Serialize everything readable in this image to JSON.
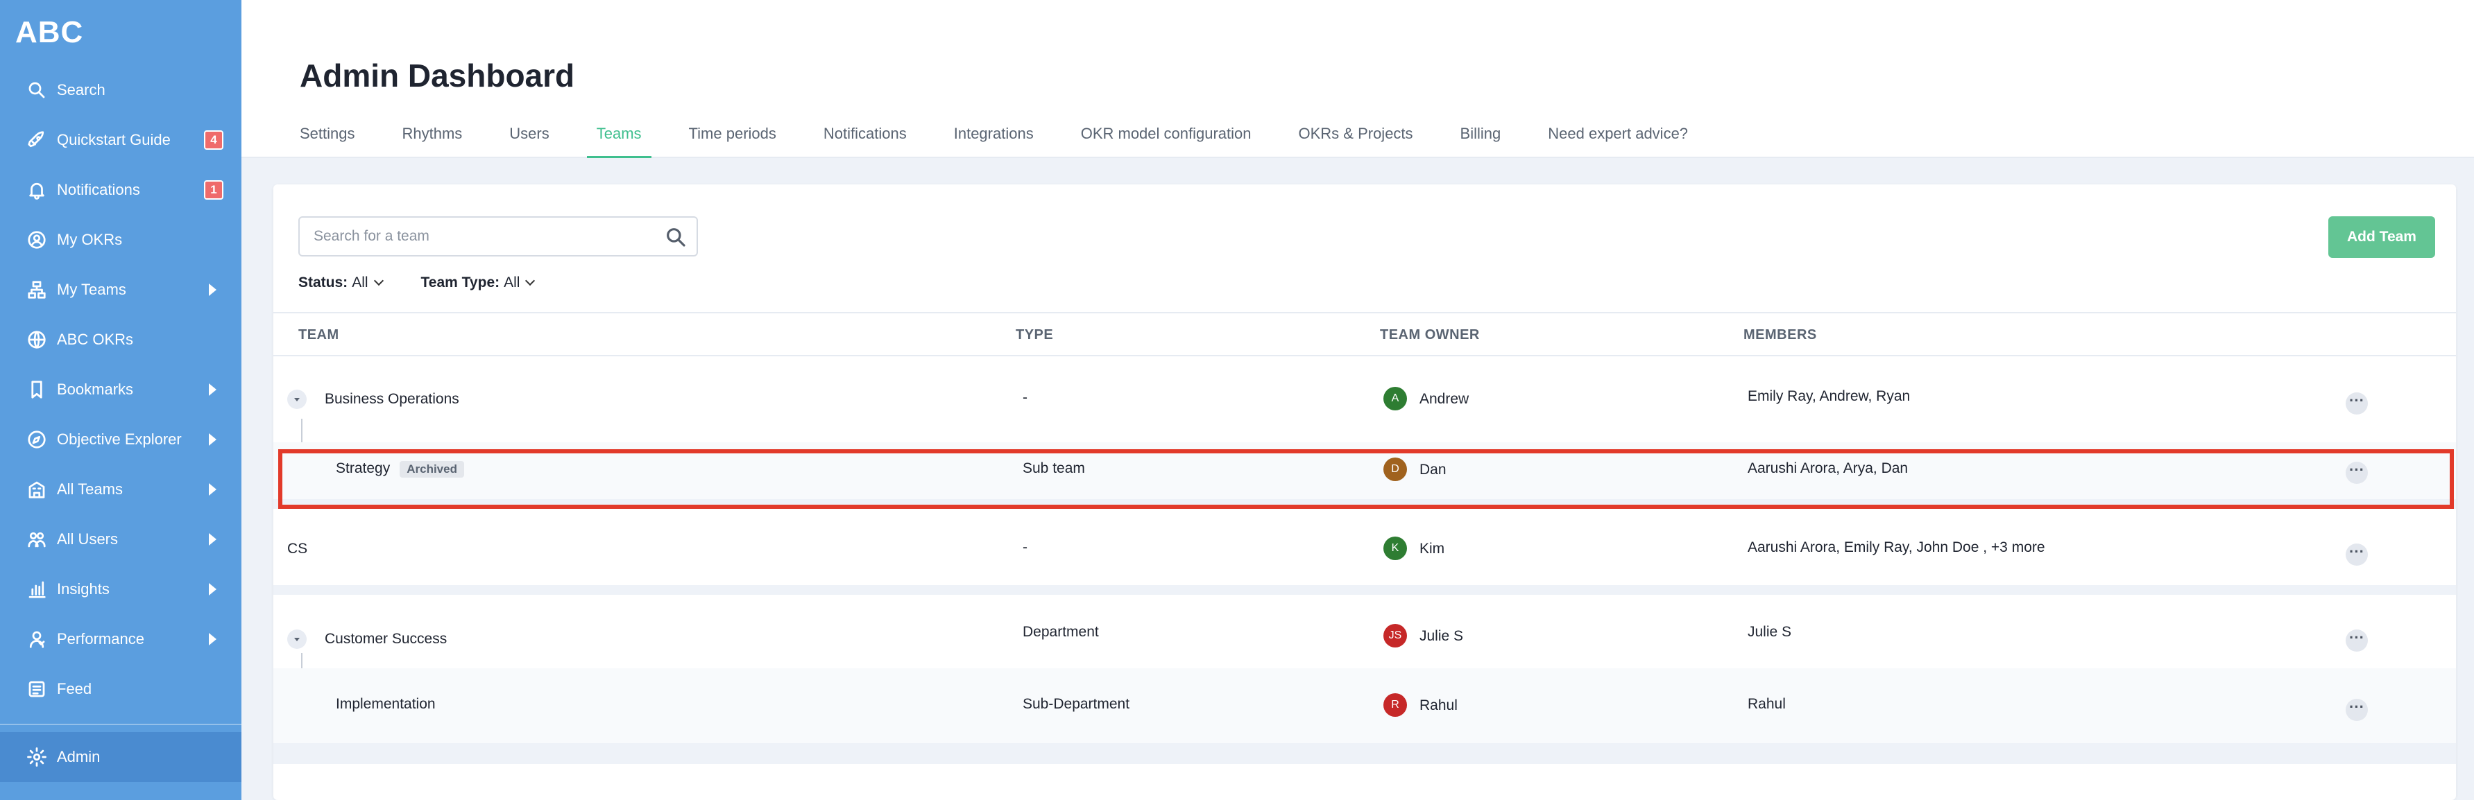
{
  "app": {
    "brand": "ABC"
  },
  "sidebar": {
    "items": [
      {
        "label": "Search",
        "icon": "search-icon"
      },
      {
        "label": "Quickstart Guide",
        "icon": "rocket-icon",
        "badge": "4"
      },
      {
        "label": "Notifications",
        "icon": "bell-icon",
        "badge": "1"
      },
      {
        "label": "My OKRs",
        "icon": "user-circle-icon"
      },
      {
        "label": "My Teams",
        "icon": "team-tree-icon"
      },
      {
        "label": "ABC OKRs",
        "icon": "globe-icon"
      },
      {
        "label": "Bookmarks",
        "icon": "bookmark-icon"
      },
      {
        "label": "Objective Explorer",
        "icon": "compass-icon"
      },
      {
        "label": "All Teams",
        "icon": "building-icon"
      },
      {
        "label": "All Users",
        "icon": "users-icon"
      },
      {
        "label": "Insights",
        "icon": "bar-chart-icon"
      },
      {
        "label": "Performance",
        "icon": "performance-icon"
      },
      {
        "label": "Feed",
        "icon": "feed-icon"
      }
    ],
    "admin": {
      "label": "Admin",
      "icon": "gear-icon"
    }
  },
  "header": {
    "title": "Admin Dashboard",
    "tabs": [
      "Settings",
      "Rhythms",
      "Users",
      "Teams",
      "Time periods",
      "Notifications",
      "Integrations",
      "OKR model configuration",
      "OKRs & Projects",
      "Billing",
      "Need expert advice?"
    ],
    "active_tab": "Teams"
  },
  "toolbar": {
    "search_placeholder": "Search for a team",
    "add_button": "Add Team",
    "filters": [
      {
        "label": "Status:",
        "value": "All"
      },
      {
        "label": "Team Type:",
        "value": "All"
      }
    ]
  },
  "table": {
    "columns": [
      "TEAM",
      "TYPE",
      "TEAM OWNER",
      "MEMBERS"
    ],
    "rows": [
      {
        "team": "Business Operations",
        "type": "-",
        "owner": "Andrew",
        "owner_initials": "A",
        "owner_color": "#2e7d32",
        "members": "Emily Ray, Andrew, Ryan",
        "expandable": true
      },
      {
        "team": "Strategy",
        "tag": "Archived",
        "type": "Sub team",
        "owner": "Dan",
        "owner_initials": "D",
        "owner_color": "#a0621e",
        "members": "Aarushi Arora, Arya, Dan",
        "child": true,
        "highlighted": true
      },
      {
        "team": "CS",
        "type": "-",
        "owner": "Kim",
        "owner_initials": "K",
        "owner_color": "#2e7d32",
        "members": "Aarushi Arora, Emily Ray, John Doe , +3 more"
      },
      {
        "team": "Customer Success",
        "type": "Department",
        "owner": "Julie S",
        "owner_initials": "JS",
        "owner_color": "#c62828",
        "members": "Julie S",
        "expandable": true
      },
      {
        "team": "Implementation",
        "type": "Sub-Department",
        "owner": "Rahul",
        "owner_initials": "R",
        "owner_color": "#c62828",
        "members": "Rahul",
        "child": true
      }
    ],
    "more_glyph": "···"
  },
  "colors": {
    "sidebar": "#5b9edf",
    "accent": "#3fbf8e",
    "highlight": "#e23a2a",
    "badge": "#ef6b6b"
  }
}
